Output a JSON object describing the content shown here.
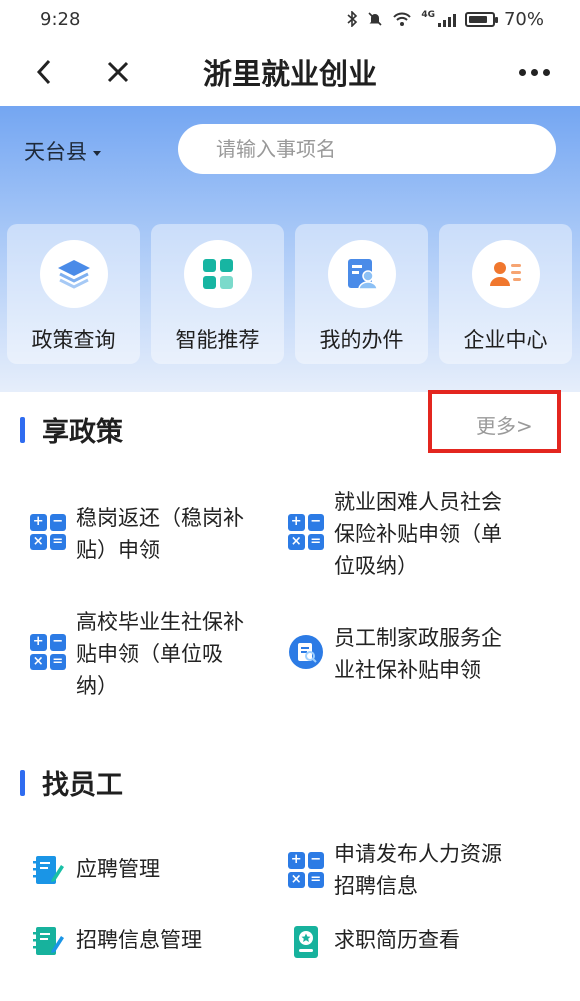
{
  "status": {
    "time": "9:28",
    "battery": "70%",
    "battery_level": 0.7,
    "network": "4G"
  },
  "nav": {
    "title": "浙里就业创业"
  },
  "region": {
    "label": "天台县"
  },
  "search": {
    "placeholder": "请输入事项名"
  },
  "quick_actions": [
    {
      "label": "政策查询",
      "icon": "layers-icon"
    },
    {
      "label": "智能推荐",
      "icon": "grid-blocks-icon"
    },
    {
      "label": "我的办件",
      "icon": "document-person-icon"
    },
    {
      "label": "企业中心",
      "icon": "contact-card-icon"
    }
  ],
  "policy": {
    "title": "享政策",
    "more": "更多>",
    "items": [
      {
        "line1": "稳岗返还（稳岗补",
        "line2": "贴）申领",
        "icon": "calculator-icon"
      },
      {
        "line1": "就业困难人员社会",
        "line2": "保险补贴申领（单",
        "line3": "位吸纳）",
        "icon": "calculator-icon"
      },
      {
        "line1": "高校毕业生社保补",
        "line2": "贴申领（单位吸",
        "line3": "纳）",
        "icon": "calculator-icon"
      },
      {
        "line1": "员工制家政服务企",
        "line2": "业社保补贴申领",
        "icon": "document-search-icon"
      }
    ]
  },
  "recruit": {
    "title": "找员工",
    "items": [
      {
        "line1": "应聘管理",
        "icon": "notebook-edit-icon"
      },
      {
        "line1": "申请发布人力资源",
        "line2": "招聘信息",
        "icon": "calculator-icon"
      },
      {
        "line1": "招聘信息管理",
        "icon": "notebook-edit-icon"
      },
      {
        "line1": "求职简历查看",
        "icon": "resume-badge-icon"
      }
    ]
  },
  "colors": {
    "accent": "#2f6cf0",
    "icon_blue": "#2c7be5",
    "icon_teal": "#1cb8a5",
    "icon_orange": "#f0772e",
    "highlight": "#e3261f"
  }
}
